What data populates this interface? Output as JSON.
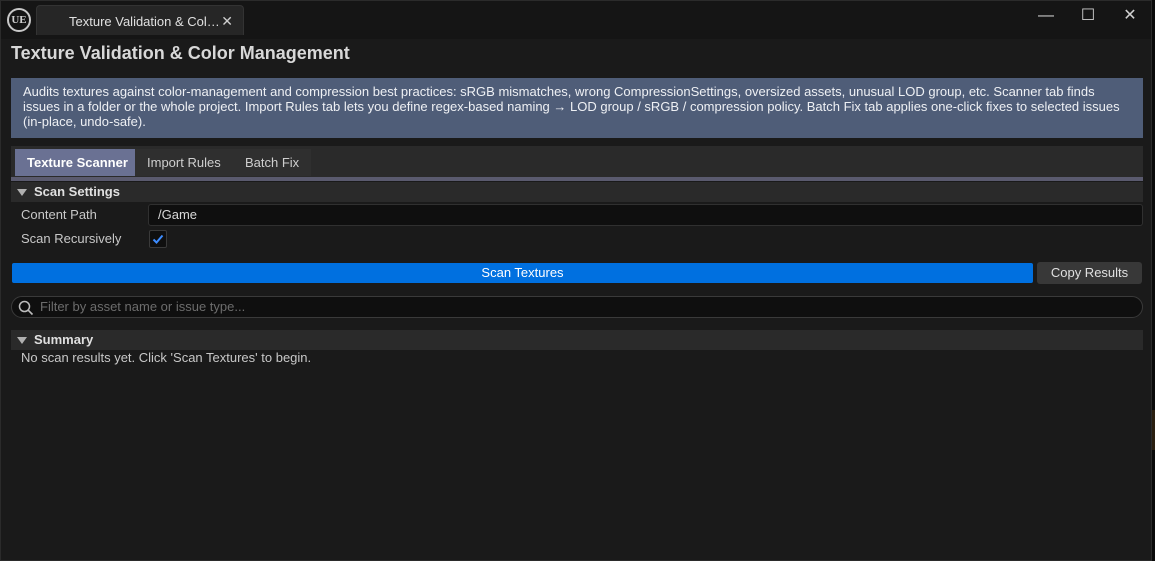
{
  "window": {
    "tab_title": "Texture Validation & Col…",
    "logo": "UE",
    "controls": {
      "minimize": "—",
      "maximize": "☐",
      "close": "✕"
    }
  },
  "panel": {
    "title": "Texture Validation & Color Management",
    "info": "Audits textures against color-management and compression best practices: sRGB mismatches, wrong CompressionSettings, oversized assets, unusual LOD group, etc. Scanner tab finds issues in a folder or the whole project. Import Rules tab lets you define regex-based naming → LOD group / sRGB / compression policy. Batch Fix tab applies one-click fixes to selected issues (in-place, undo-safe)."
  },
  "tabs": [
    {
      "label": "Texture Scanner",
      "active": true
    },
    {
      "label": "Import Rules",
      "active": false
    },
    {
      "label": "Batch Fix",
      "active": false
    }
  ],
  "scan_settings": {
    "header": "Scan Settings",
    "content_path_label": "Content Path",
    "content_path_value": "/Game",
    "recursive_label": "Scan Recursively",
    "recursive_checked": true
  },
  "actions": {
    "scan_label": "Scan Textures",
    "copy_label": "Copy Results"
  },
  "filter": {
    "placeholder": "Filter by asset name or issue type..."
  },
  "summary": {
    "header": "Summary",
    "text": "No scan results yet. Click 'Scan Textures' to begin."
  },
  "colors": {
    "accent_blue": "#0070e0",
    "info_bg": "#4f5d78",
    "active_tab": "#6a7193"
  }
}
